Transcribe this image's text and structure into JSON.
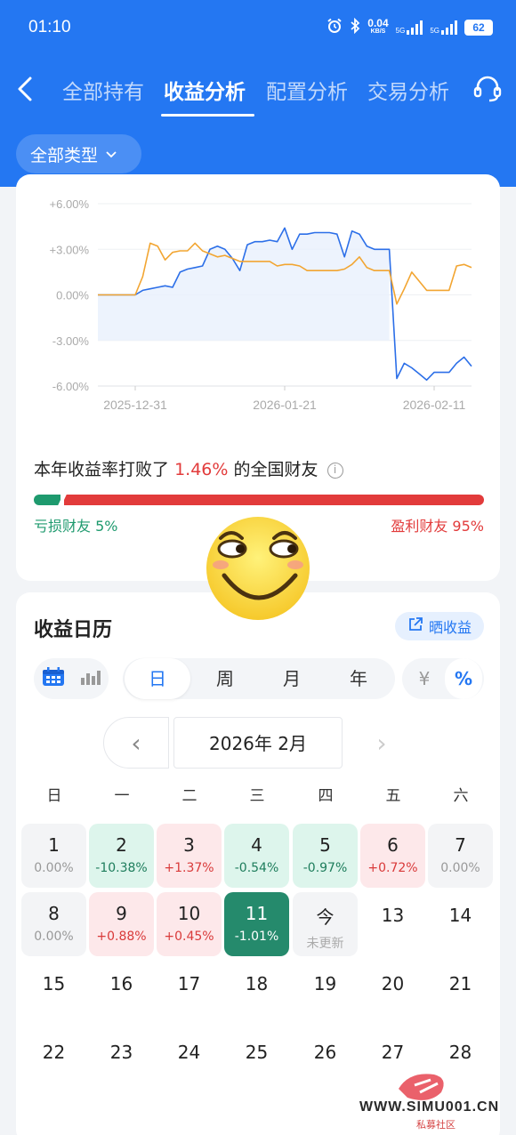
{
  "status": {
    "time": "01:10",
    "net_speed": "0.04",
    "net_unit": "KB/S",
    "sig1": "5G",
    "sig2": "5G",
    "battery": "62"
  },
  "nav": {
    "tabs": [
      {
        "label": "全部持有",
        "active": false
      },
      {
        "label": "收益分析",
        "active": true
      },
      {
        "label": "配置分析",
        "active": false
      },
      {
        "label": "交易分析",
        "active": false
      }
    ]
  },
  "filter": {
    "type_label": "全部类型"
  },
  "chart_data": {
    "type": "line",
    "y_ticks": [
      "+6.00%",
      "+3.00%",
      "0.00%",
      "-3.00%",
      "-6.00%"
    ],
    "ylim": [
      -6,
      6
    ],
    "x_ticks": [
      "2025-12-31",
      "2026-01-21",
      "2026-02-11"
    ],
    "series": [
      {
        "color": "#2c6fe8",
        "values": [
          0,
          0,
          0,
          0,
          0,
          0,
          0.3,
          0.4,
          0.5,
          0.6,
          0.5,
          1.5,
          1.7,
          1.8,
          1.9,
          3.0,
          3.2,
          3.0,
          2.4,
          1.6,
          3.3,
          3.5,
          3.5,
          3.6,
          3.5,
          4.4,
          3.0,
          4.0,
          4.0,
          4.1,
          4.1,
          4.1,
          4.0,
          2.5,
          4.2,
          4.0,
          3.2,
          3.0,
          3.0,
          3.0,
          -5.5,
          -4.5,
          -4.8,
          -5.2,
          -5.6,
          -5.1,
          -5.1,
          -5.1,
          -4.5,
          -4.1,
          -4.7
        ]
      },
      {
        "color": "#f2a531",
        "values": [
          0,
          0,
          0,
          0,
          0,
          0,
          1.2,
          3.4,
          3.2,
          2.3,
          2.8,
          2.9,
          2.9,
          3.4,
          2.9,
          2.7,
          2.5,
          2.6,
          2.4,
          2.2,
          2.2,
          2.2,
          2.2,
          2.2,
          1.9,
          2.0,
          2.0,
          1.9,
          1.6,
          1.6,
          1.6,
          1.6,
          1.6,
          1.7,
          2.0,
          2.5,
          1.8,
          1.6,
          1.6,
          1.6,
          -0.6,
          0.4,
          1.5,
          0.9,
          0.3,
          0.3,
          0.3,
          0.3,
          1.9,
          2.0,
          1.8
        ]
      }
    ]
  },
  "beat": {
    "prefix": "本年收益率打败了",
    "value": "1.46%",
    "suffix": "的全国财友",
    "info": "i"
  },
  "ratio": {
    "loss_label": "亏损财友 5%",
    "win_label": "盈利财友 95%",
    "loss_pct": 5
  },
  "calendar": {
    "title": "收益日历",
    "share_label": "晒收益",
    "period_tabs": [
      "日",
      "周",
      "月",
      "年"
    ],
    "unit_yen": "¥",
    "unit_pct": "%",
    "month_label": "2026年 2月",
    "prev": "‹",
    "next": "›",
    "weekdays": [
      "日",
      "一",
      "二",
      "三",
      "四",
      "五",
      "六"
    ],
    "weeks": [
      [
        {
          "day": "1",
          "value": "0.00%",
          "style": "gray"
        },
        {
          "day": "2",
          "value": "-10.38%",
          "style": "green"
        },
        {
          "day": "3",
          "value": "+1.37%",
          "style": "red"
        },
        {
          "day": "4",
          "value": "-0.54%",
          "style": "green"
        },
        {
          "day": "5",
          "value": "-0.97%",
          "style": "green"
        },
        {
          "day": "6",
          "value": "+0.72%",
          "style": "red"
        },
        {
          "day": "7",
          "value": "0.00%",
          "style": "gray"
        }
      ],
      [
        {
          "day": "8",
          "value": "0.00%",
          "style": "gray"
        },
        {
          "day": "9",
          "value": "+0.88%",
          "style": "red"
        },
        {
          "day": "10",
          "value": "+0.45%",
          "style": "red"
        },
        {
          "day": "11",
          "value": "-1.01%",
          "style": "dark"
        },
        {
          "day": "今",
          "value": "未更新",
          "style": "gray today"
        },
        {
          "day": "13",
          "value": "",
          "style": "plain"
        },
        {
          "day": "14",
          "value": "",
          "style": "plain"
        }
      ],
      [
        {
          "day": "15",
          "value": "",
          "style": "plain"
        },
        {
          "day": "16",
          "value": "",
          "style": "plain"
        },
        {
          "day": "17",
          "value": "",
          "style": "plain"
        },
        {
          "day": "18",
          "value": "",
          "style": "plain"
        },
        {
          "day": "19",
          "value": "",
          "style": "plain"
        },
        {
          "day": "20",
          "value": "",
          "style": "plain"
        },
        {
          "day": "21",
          "value": "",
          "style": "plain"
        }
      ],
      [
        {
          "day": "22",
          "value": "",
          "style": "plain"
        },
        {
          "day": "23",
          "value": "",
          "style": "plain"
        },
        {
          "day": "24",
          "value": "",
          "style": "plain"
        },
        {
          "day": "25",
          "value": "",
          "style": "plain"
        },
        {
          "day": "26",
          "value": "",
          "style": "plain"
        },
        {
          "day": "27",
          "value": "",
          "style": "plain"
        },
        {
          "day": "28",
          "value": "",
          "style": "plain"
        }
      ]
    ]
  },
  "watermark": {
    "url": "WWW.SIMU001.CN",
    "sub": "私募社区"
  },
  "colors": {
    "brand": "#2477f2",
    "gain": "#e23b3b",
    "loss": "#1e9a6e"
  }
}
